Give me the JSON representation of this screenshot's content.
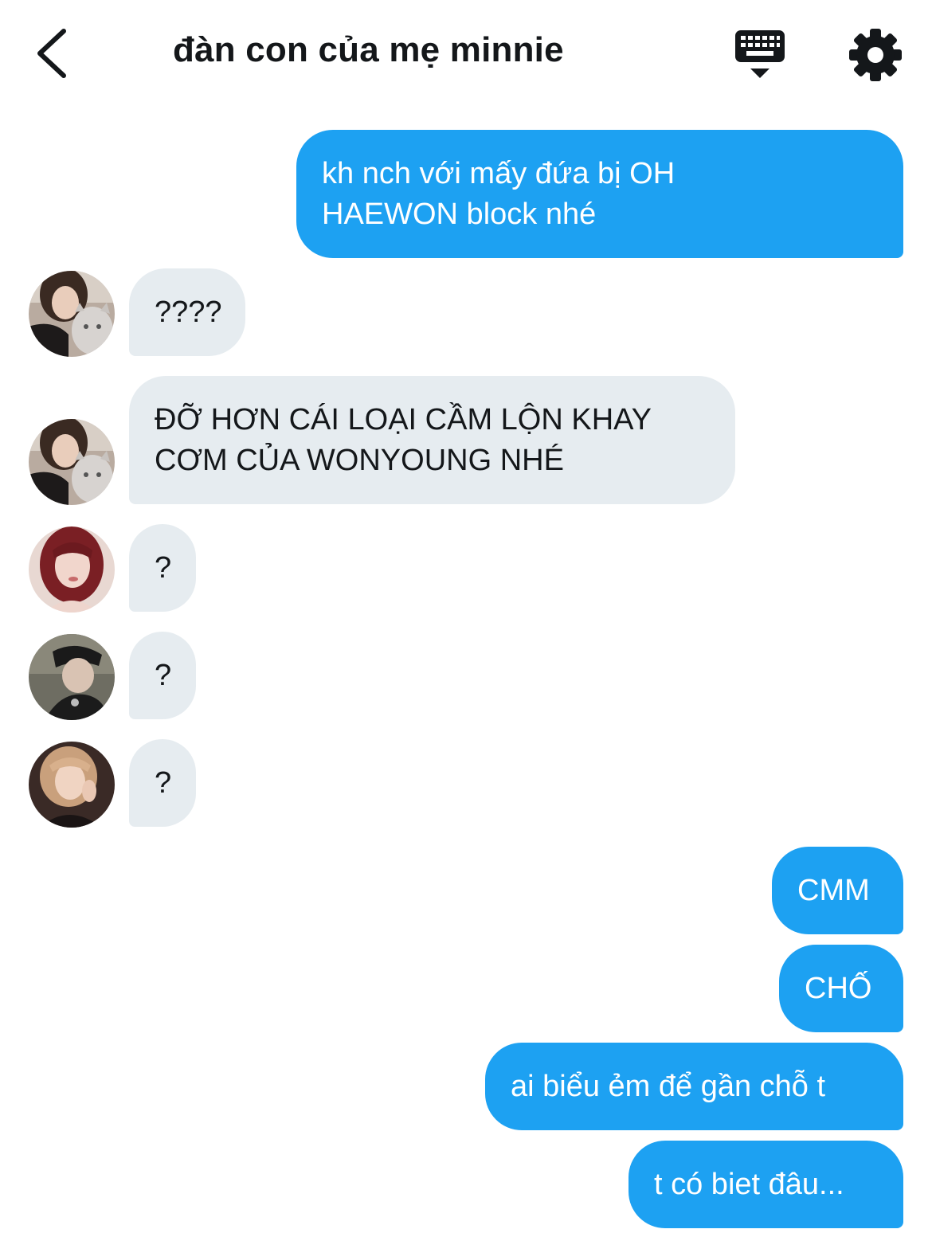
{
  "header": {
    "title": "đàn con của mẹ minnie",
    "back_icon": "chevron-left-icon",
    "keyboard_icon": "keyboard-icon",
    "settings_icon": "gear-icon"
  },
  "colors": {
    "outgoing_bubble": "#1da1f2",
    "incoming_bubble": "#e6ecf0",
    "text_dark": "#14171a"
  },
  "messages": [
    {
      "direction": "outgoing",
      "lines": [
        "kh nch với mấy đứa bị OH",
        "HAEWON block nhé"
      ]
    },
    {
      "direction": "incoming",
      "lines": [
        "????"
      ]
    },
    {
      "direction": "incoming",
      "lines": [
        "ĐỠ HƠN CÁI LOẠI CẦM LỘN KHAY",
        "CƠM CỦA WONYOUNG NHÉ"
      ]
    },
    {
      "direction": "incoming",
      "lines": [
        "?"
      ]
    },
    {
      "direction": "incoming",
      "lines": [
        "?"
      ]
    },
    {
      "direction": "incoming",
      "lines": [
        "?"
      ]
    },
    {
      "direction": "outgoing",
      "lines": [
        "CMM"
      ]
    },
    {
      "direction": "outgoing",
      "lines": [
        "CHỐ"
      ]
    },
    {
      "direction": "outgoing",
      "lines": [
        "ai biểu ẻm để gần chỗ t"
      ]
    },
    {
      "direction": "outgoing",
      "lines": [
        "t có biet đâu..."
      ]
    }
  ]
}
